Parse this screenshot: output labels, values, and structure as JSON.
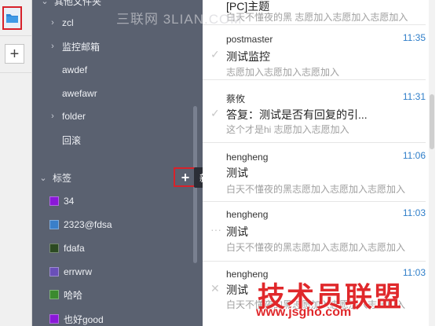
{
  "rail": {
    "folder_icon": "folder-icon",
    "add_icon": "plus-icon",
    "add_label": "+"
  },
  "panel": {
    "top_partial": "其他文件夹",
    "folders": [
      {
        "label": "zcl",
        "has_children": true
      },
      {
        "label": "监控邮箱",
        "has_children": true
      },
      {
        "label": "awdef",
        "has_children": false
      },
      {
        "label": "awefawr",
        "has_children": false
      },
      {
        "label": "folder",
        "has_children": true
      },
      {
        "label": "回滚",
        "has_children": false
      }
    ],
    "tags_section": {
      "label": "标签",
      "add_label": "+",
      "tooltip": "新建标签"
    },
    "tags": [
      {
        "label": "34",
        "color": "#8a18d8"
      },
      {
        "label": "2323@fdsa",
        "color": "#3a7fc9"
      },
      {
        "label": "fdafa",
        "color": "#2c4a22"
      },
      {
        "label": "errwrw",
        "color": "#6a4fb8"
      },
      {
        "label": "哈哈",
        "color": "#3b8a2e"
      },
      {
        "label": "也好good",
        "color": "#8a18d8"
      }
    ]
  },
  "mails": [
    {
      "from": "",
      "time": "",
      "subject": "[PC]主题",
      "preview": "白天不懂夜的黑 志愿加入志愿加入志愿加入",
      "status": ""
    },
    {
      "from": "postmaster",
      "time": "11:35",
      "subject": "测试监控",
      "preview": "志愿加入志愿加入志愿加入",
      "status": "✓"
    },
    {
      "from": "蔡攸",
      "time": "11:31",
      "subject": "答复：测试是否有回复的引...",
      "preview": "这个才是hi 志愿加入志愿加入",
      "status": "✓"
    },
    {
      "from": "hengheng",
      "time": "11:06",
      "subject": "测试",
      "preview": "白天不懂夜的黑志愿加入志愿加入志愿加入",
      "status": ""
    },
    {
      "from": "hengheng",
      "time": "11:03",
      "subject": "测试",
      "preview": "白天不懂夜的黑志愿加入志愿加入志愿加入",
      "status": "···"
    },
    {
      "from": "hengheng",
      "time": "11:03",
      "subject": "测试",
      "preview": "白天不懂夜的黑志愿加入志愿加入志愿加入",
      "status": "✕"
    }
  ],
  "watermarks": {
    "top": "三联网 3LIAN.COM",
    "brand": "技术员联盟",
    "site": "www.jsgho.com"
  }
}
